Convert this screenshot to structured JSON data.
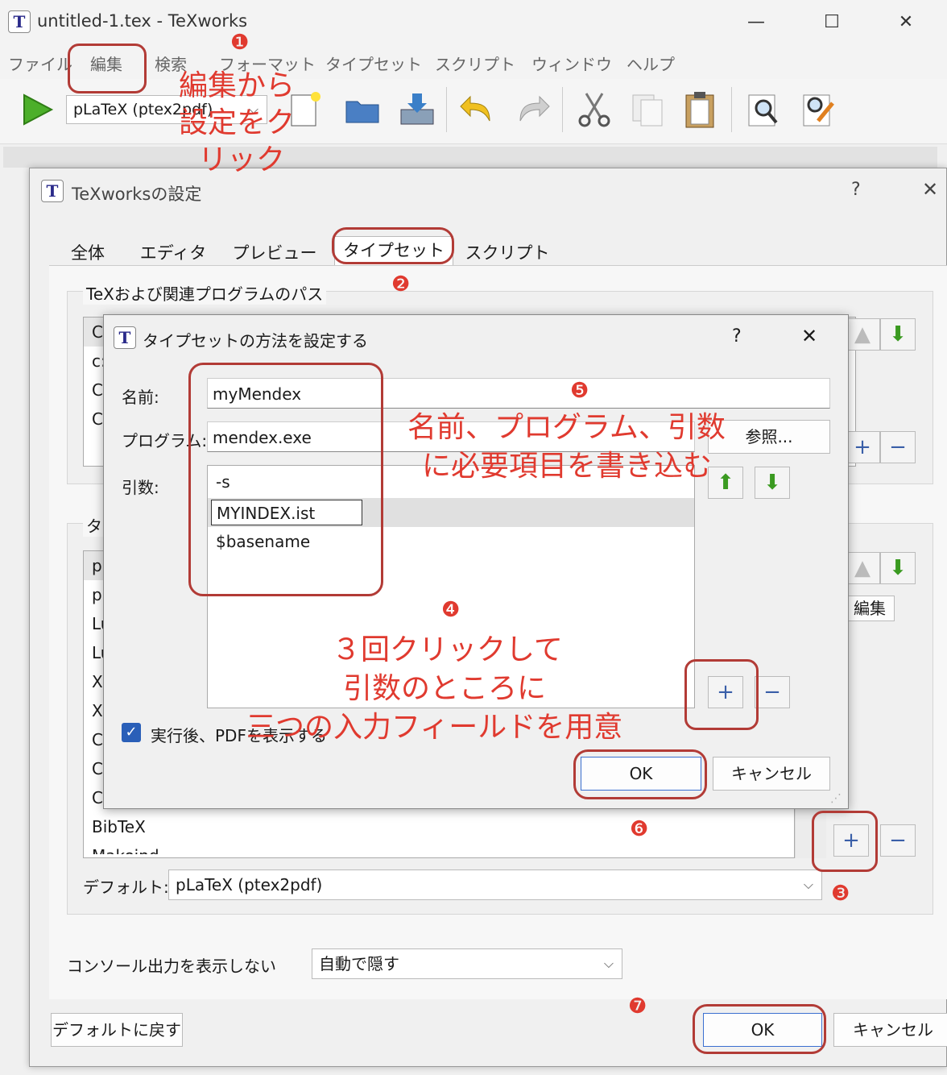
{
  "main_window": {
    "icon": "TeX-icon",
    "title": "untitled-1.tex - TeXworks",
    "menu": [
      "ファイル",
      "編集",
      "検索",
      "フォーマット",
      "タイプセット",
      "スクリプト",
      "ウィンドウ",
      "ヘルプ"
    ],
    "engine": "pLaTeX (ptex2pdf)",
    "window_buttons": {
      "minimize": "—",
      "maximize": "☐",
      "close": "✕"
    }
  },
  "settings_dialog": {
    "title": "TeXworksの設定",
    "help": "?",
    "close": "✕",
    "tabs": [
      "全体",
      "エディタ",
      "プレビュー",
      "タイプセット",
      "スクリプト"
    ],
    "selected_tab": "タイプセット",
    "paths_group_label": "TeXおよび関連プログラムのパス",
    "paths_list_fragments": [
      "C",
      "c:",
      "C",
      "C"
    ],
    "tools_group_label": "タ",
    "tools_list_fragments": [
      "p",
      "p",
      "Lu",
      "Lu",
      "X",
      "X",
      "C",
      "C",
      "C"
    ],
    "bibtex_row": "BibTeX",
    "partial_row": "Makeind",
    "edit_button": "編集",
    "default_label": "デフォルト:",
    "default_value": "pLaTeX (ptex2pdf)",
    "console_label": "コンソール出力を表示しない",
    "console_value": "自動で隠す",
    "restore_defaults": "デフォルトに戻す",
    "ok": "OK",
    "cancel": "キャンセル"
  },
  "typeset_dialog": {
    "title": "タイプセットの方法を設定する",
    "help": "?",
    "close": "✕",
    "name_label": "名前:",
    "name_value": "myMendex",
    "program_label": "プログラム:",
    "program_value": "mendex.exe",
    "browse": "参照...",
    "args_label": "引数:",
    "args": [
      "-s",
      "MYINDEX.ist",
      "$basename"
    ],
    "show_pdf_label": "実行後、PDFを表示する",
    "show_pdf_checked": true,
    "ok": "OK",
    "cancel": "キャンセル"
  },
  "annotations": {
    "step1_number": "❶",
    "step1_text": [
      "編集から",
      "設定をク",
      "リック"
    ],
    "step2_number": "❷",
    "step3_number": "❸",
    "step4_number": "❹",
    "step4_text": [
      "３回クリックして",
      "引数のところに",
      "三つの入力フィールドを用意"
    ],
    "step5_number": "❺",
    "step5_text": [
      "名前、プログラム、引数",
      "に必要項目を書き込む"
    ],
    "step6_number": "❻",
    "step7_number": "❼",
    "highlight_color": "#b23b36",
    "text_color": "#e03a2f"
  }
}
